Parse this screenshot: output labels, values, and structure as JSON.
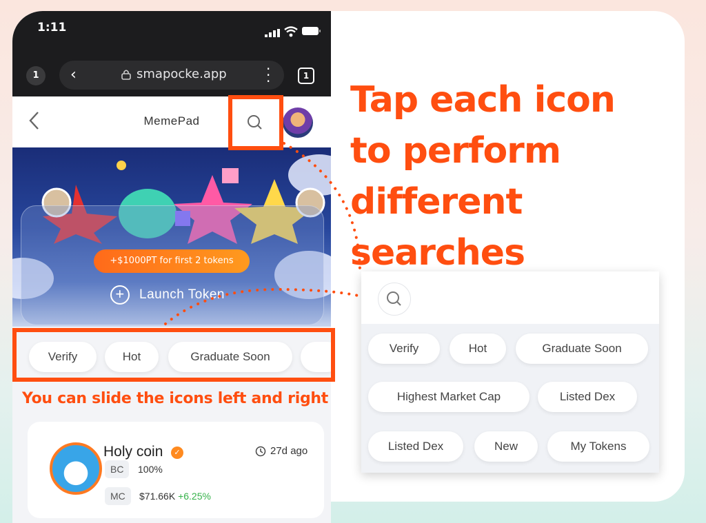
{
  "status_bar": {
    "time": "1:11"
  },
  "browser": {
    "tab_count_left": "1",
    "url": "smapocke.app",
    "tab_count_right": "1"
  },
  "app_header": {
    "title": "MemePad"
  },
  "banner": {
    "promo": "+$1000PT for first 2 tokens",
    "launch_label": "Launch Token"
  },
  "filter_chips": [
    "Verify",
    "Hot",
    "Graduate Soon"
  ],
  "slide_note": "You can slide the icons left and right",
  "token_card": {
    "name": "Holy coin",
    "age": "27d ago",
    "bc_label": "BC",
    "bc_value": "100%",
    "mc_label": "MC",
    "mc_value": "$71.66K",
    "mc_change": "+6.25%"
  },
  "headline": {
    "line1": "Tap each icon",
    "line2": "to perform",
    "line3": "different searches"
  },
  "search_panel": {
    "chips": [
      "Verify",
      "Hot",
      "Graduate Soon",
      "Highest Market Cap",
      "Listed Dex",
      "Listed Dex",
      "New",
      "My Tokens"
    ]
  },
  "colors": {
    "accent": "#ff4e10",
    "positive": "#36b24a",
    "promo": "#ff7a1a"
  },
  "icons": [
    "search-icon",
    "chevron-left-icon",
    "lock-icon",
    "kebab-icon",
    "plus-circle-icon",
    "clock-icon",
    "verified-icon"
  ]
}
